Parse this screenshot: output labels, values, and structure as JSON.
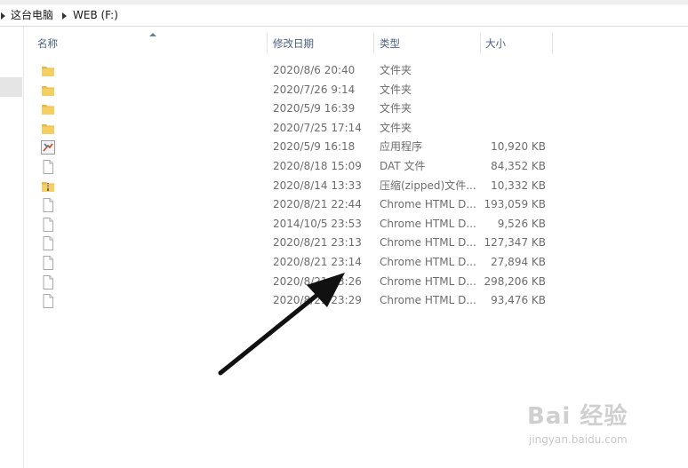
{
  "address": {
    "crumbs": [
      "这台电脑",
      "WEB (F:)"
    ]
  },
  "columns": {
    "name": "名称",
    "modified": "修改日期",
    "type": "类型",
    "size": "大小"
  },
  "files": [
    {
      "icon": "folder-icon",
      "modified": "2020/8/6 20:40",
      "type": "文件夹",
      "size": ""
    },
    {
      "icon": "folder-icon",
      "modified": "2020/7/26 9:14",
      "type": "文件夹",
      "size": ""
    },
    {
      "icon": "folder-icon",
      "modified": "2020/5/9 16:39",
      "type": "文件夹",
      "size": ""
    },
    {
      "icon": "folder-icon",
      "modified": "2020/7/25 17:14",
      "type": "文件夹",
      "size": ""
    },
    {
      "icon": "application-icon",
      "modified": "2020/5/9 16:18",
      "type": "应用程序",
      "size": "10,920 KB"
    },
    {
      "icon": "file-icon",
      "modified": "2020/8/18 15:09",
      "type": "DAT 文件",
      "size": "84,352 KB"
    },
    {
      "icon": "zip-folder-icon",
      "modified": "2020/8/14 13:33",
      "type": "压缩(zipped)文件...",
      "size": "10,332 KB"
    },
    {
      "icon": "file-icon",
      "modified": "2020/8/21 22:44",
      "type": "Chrome HTML D...",
      "size": "193,059 KB"
    },
    {
      "icon": "file-icon",
      "modified": "2014/10/5 23:53",
      "type": "Chrome HTML D...",
      "size": "9,526 KB"
    },
    {
      "icon": "file-icon",
      "modified": "2020/8/21 23:13",
      "type": "Chrome HTML D...",
      "size": "127,347 KB"
    },
    {
      "icon": "file-icon",
      "modified": "2020/8/21 23:14",
      "type": "Chrome HTML D...",
      "size": "27,894 KB"
    },
    {
      "icon": "file-icon",
      "modified": "2020/8/21 23:26",
      "type": "Chrome HTML D...",
      "size": "298,206 KB"
    },
    {
      "icon": "file-icon",
      "modified": "2020/8/21 23:29",
      "type": "Chrome HTML D...",
      "size": "93,476 KB"
    }
  ],
  "watermark": {
    "main": "Bai 经验",
    "sub": "jingyan.baidu.com"
  },
  "annotation_arrow": {
    "icon": "arrow-annotation",
    "color": "#111111"
  }
}
